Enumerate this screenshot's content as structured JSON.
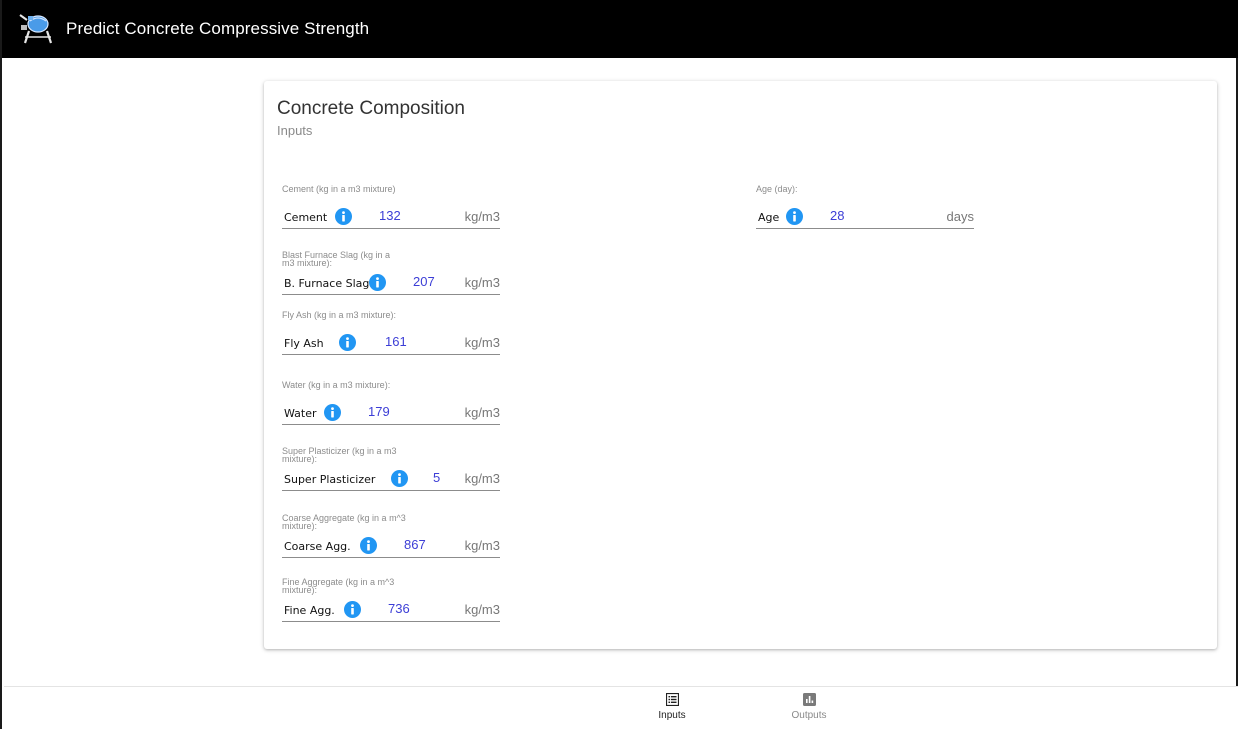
{
  "app": {
    "title": "Predict Concrete Compressive Strength",
    "logo_icon": "concrete-mixer-icon"
  },
  "card": {
    "title": "Concrete Composition",
    "subtitle": "Inputs"
  },
  "fields": {
    "cement": {
      "caption": "Cement (kg in a m3 mixture)",
      "name": "Cement",
      "value": "132",
      "unit": "kg/m3"
    },
    "slag": {
      "caption": "Blast Furnace Slag (kg in a m3 mixture):",
      "name": "B. Furnace Slag",
      "value": "207",
      "unit": "kg/m3"
    },
    "flyash": {
      "caption": "Fly Ash (kg in a m3 mixture):",
      "name": "Fly Ash",
      "value": "161",
      "unit": "kg/m3"
    },
    "water": {
      "caption": "Water (kg in a m3 mixture):",
      "name": "Water",
      "value": "179",
      "unit": "kg/m3"
    },
    "plasticizer": {
      "caption": "Super Plasticizer (kg in a m3 mixture):",
      "name": "Super Plasticizer",
      "value": "5",
      "unit": "kg/m3"
    },
    "coarse": {
      "caption": "Coarse Aggregate (kg in a m^3 mixture):",
      "name": "Coarse Agg.",
      "value": "867",
      "unit": "kg/m3"
    },
    "fine": {
      "caption": "Fine Aggregate (kg in a m^3 mixture):",
      "name": "Fine Agg.",
      "value": "736",
      "unit": "kg/m3"
    },
    "age": {
      "caption": "Age (day):",
      "name": "Age",
      "value": "28",
      "unit": "days"
    }
  },
  "nav": {
    "inputs": {
      "label": "Inputs",
      "icon": "list-icon",
      "active": true
    },
    "outputs": {
      "label": "Outputs",
      "icon": "bar-chart-icon",
      "active": false
    }
  },
  "colors": {
    "appbar": "#000000",
    "value_text": "#3c3ed6",
    "info_icon": "#2196f3"
  }
}
